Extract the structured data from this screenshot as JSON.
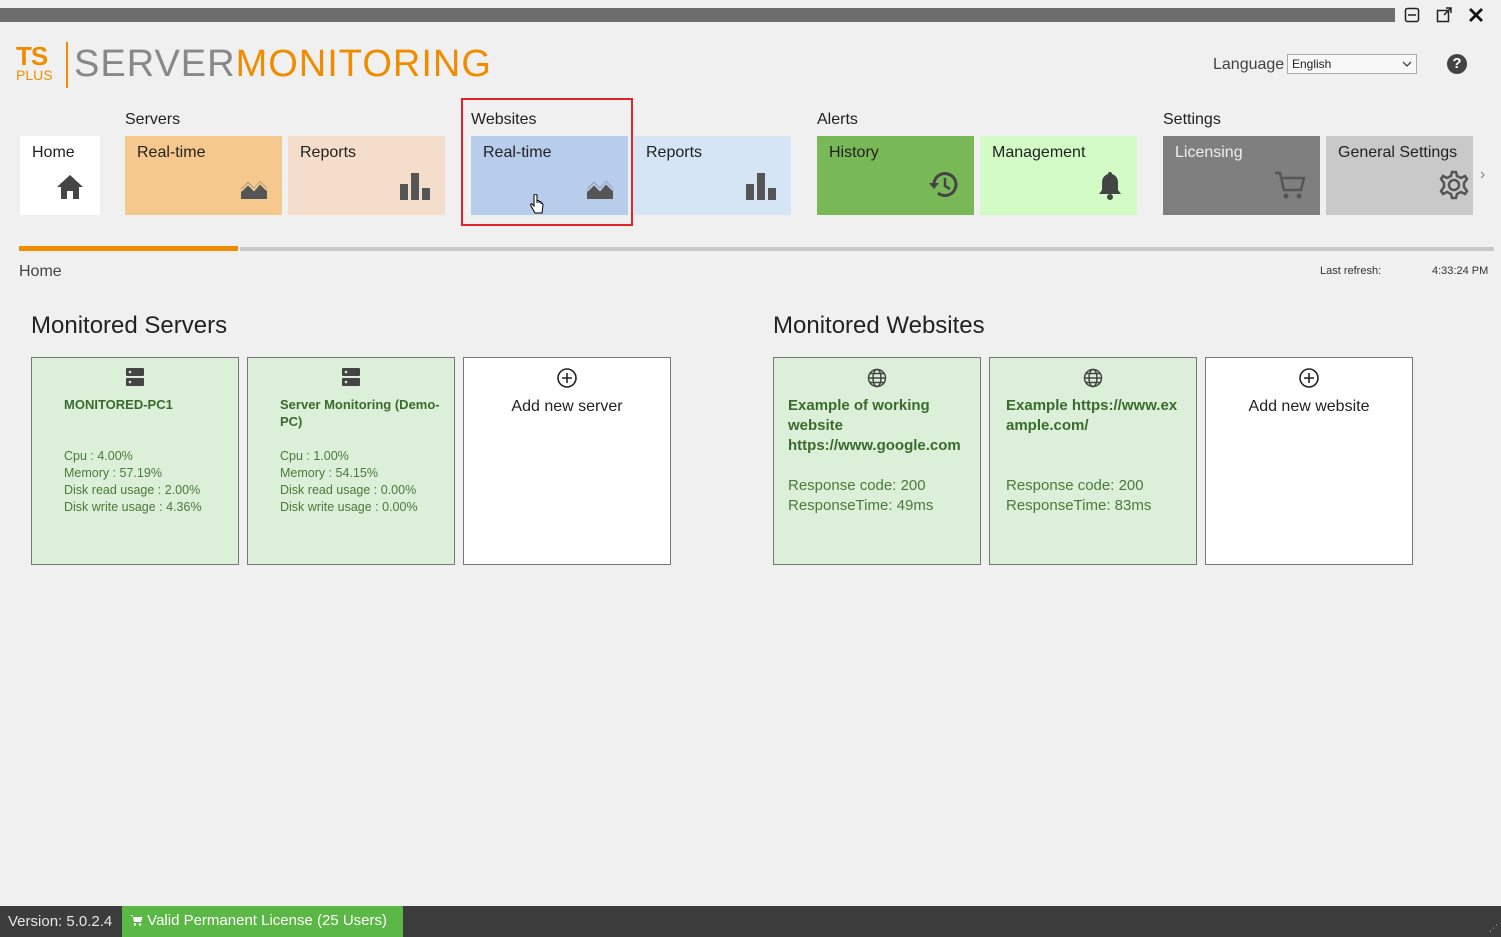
{
  "window": {
    "minimize_label": "minimize",
    "popout_label": "pop out",
    "close_label": "close"
  },
  "logo": {
    "ts": "TS",
    "plus": "PLUS",
    "server": "SERVER",
    "monitoring": "MONITORING"
  },
  "language": {
    "label": "Language",
    "value": "English"
  },
  "help": {
    "label": "?"
  },
  "nav": {
    "home": {
      "label": "Home",
      "icon": "home-icon"
    },
    "servers": {
      "header": "Servers",
      "realtime": {
        "label": "Real-time",
        "icon": "chart-area-icon"
      },
      "reports": {
        "label": "Reports",
        "icon": "bar-chart-icon"
      }
    },
    "websites": {
      "header": "Websites",
      "realtime": {
        "label": "Real-time",
        "icon": "chart-area-icon"
      },
      "reports": {
        "label": "Reports",
        "icon": "bar-chart-icon"
      }
    },
    "alerts": {
      "header": "Alerts",
      "history": {
        "label": "History",
        "icon": "history-icon"
      },
      "management": {
        "label": "Management",
        "icon": "bell-icon"
      }
    },
    "settings": {
      "header": "Settings",
      "licensing": {
        "label": "Licensing",
        "icon": "cart-icon"
      },
      "general": {
        "label": "General Settings",
        "icon": "gear-icon"
      }
    },
    "more": "›"
  },
  "page": {
    "title": "Home",
    "last_refresh_label": "Last refresh:",
    "last_refresh_time": "4:33:24 PM",
    "progress": 0.17
  },
  "servers": {
    "title": "Monitored Servers",
    "items": [
      {
        "name": "MONITORED-PC1",
        "cpu": "Cpu : 4.00%",
        "memory": "Memory : 57.19%",
        "disk_read": "Disk read usage : 2.00%",
        "disk_write": "Disk write usage : 4.36%"
      },
      {
        "name": "Server Monitoring (Demo-PC)",
        "cpu": "Cpu : 1.00%",
        "memory": "Memory : 54.15%",
        "disk_read": "Disk read usage : 0.00%",
        "disk_write": "Disk write usage : 0.00%"
      }
    ],
    "add_label": "Add new server"
  },
  "websites": {
    "title": "Monitored Websites",
    "items": [
      {
        "name": "Example of working website https://www.google.com",
        "response_code": "Response code: 200",
        "response_time": "ResponseTime: 49ms"
      },
      {
        "name": "Example https://www.example.com/",
        "response_code": "Response code: 200",
        "response_time": "ResponseTime: 83ms"
      }
    ],
    "add_label": "Add new website"
  },
  "footer": {
    "version": "Version: 5.0.2.4",
    "license": "Valid Permanent License (25 Users)"
  },
  "colors": {
    "accent_orange": "#f08c00",
    "server_realtime": "#f5c98e",
    "server_reports": "#f5ddcc",
    "website_realtime": "#b8cdec",
    "website_reports": "#d5e5f5",
    "history": "#78b857",
    "management": "#d2fbc6",
    "licensing": "#7f7f7f",
    "general_settings": "#c9c9c9",
    "card_green": "#dcefd8",
    "license_badge": "#5bb846",
    "highlight": "#e0252a"
  }
}
